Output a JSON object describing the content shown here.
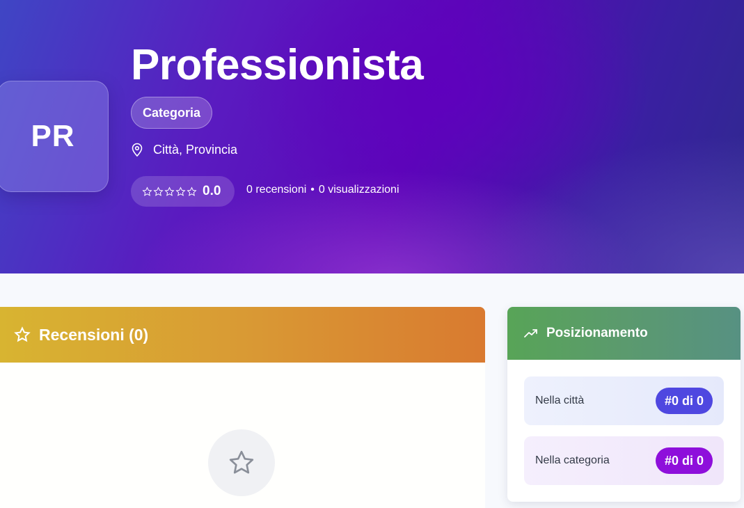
{
  "profile": {
    "initials": "PR",
    "name": "Professionista",
    "category": "Categoria",
    "location": "Città, Provincia",
    "rating": "0.0",
    "stars": 0,
    "reviews_count": "0 recensioni",
    "separator": "•",
    "views_count": "0 visualizzazioni"
  },
  "reviews": {
    "title": "Recensioni (0)"
  },
  "positioning": {
    "title": "Posizionamento",
    "city_label": "Nella città",
    "city_rank": "#0 di 0",
    "category_label": "Nella categoria",
    "category_rank": "#0 di 0"
  },
  "colors": {
    "reviews_header": "#d99a34",
    "positioning_header": "#5b9a6e",
    "city_badge": "#4f47e0",
    "category_badge": "#8e0fdb"
  },
  "icons": {
    "location": "map-pin-icon",
    "rating": "star-icon",
    "reviews": "star-icon",
    "positioning": "trending-up-icon",
    "empty_state": "star-icon"
  }
}
